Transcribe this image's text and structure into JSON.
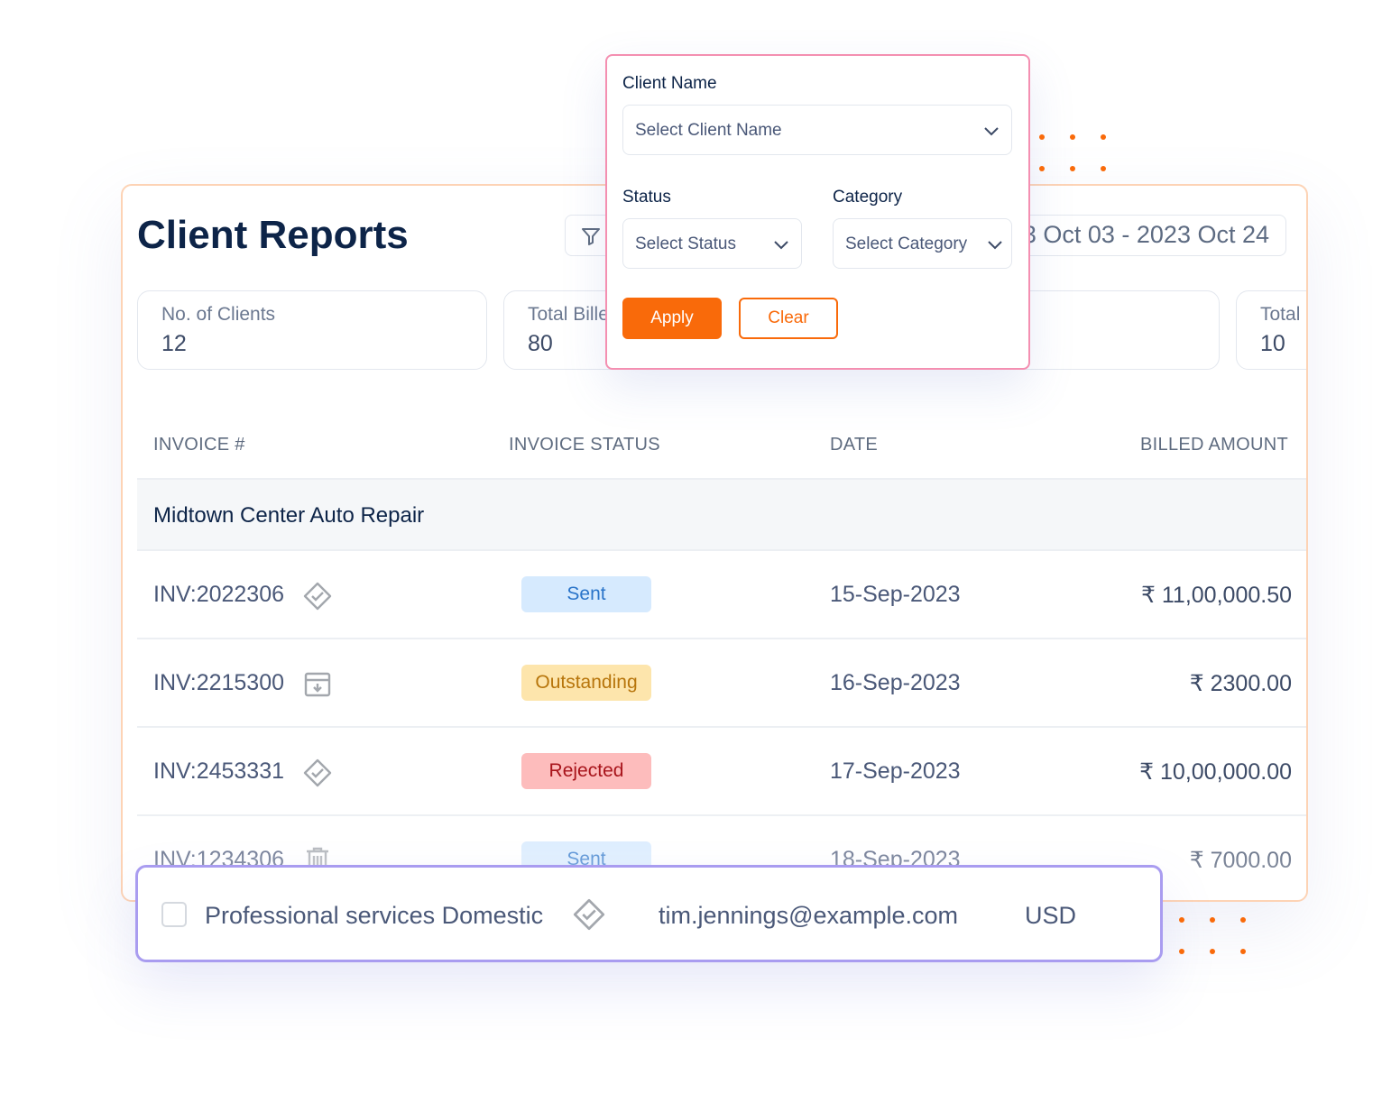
{
  "page": {
    "title": "Client Reports",
    "date_range": "2023 Oct 03 - 2023 Oct 24"
  },
  "stats": [
    {
      "label": "No. of Clients",
      "value": "12"
    },
    {
      "label": "Total Billed",
      "value": "80"
    },
    {
      "label": "",
      "value": ""
    },
    {
      "label": "Total",
      "value": "10"
    }
  ],
  "table": {
    "headers": [
      "INVOICE #",
      "INVOICE STATUS",
      "DATE",
      "BILLED AMOUNT"
    ],
    "group": "Midtown Center Auto Repair",
    "rows": [
      {
        "invoice": "INV:2022306",
        "icon": "approved-check-icon",
        "status": "Sent",
        "date": "15-Sep-2023",
        "amount": "₹ 11,00,000.50"
      },
      {
        "invoice": "INV:2215300",
        "icon": "archive-download-icon",
        "status": "Outstanding",
        "date": "16-Sep-2023",
        "amount": "₹ 2300.00"
      },
      {
        "invoice": "INV:2453331",
        "icon": "approved-check-icon",
        "status": "Rejected",
        "date": "17-Sep-2023",
        "amount": "₹ 10,00,000.00"
      },
      {
        "invoice": "INV:1234306",
        "icon": "trash-icon",
        "status": "Sent",
        "date": "18-Sep-2023",
        "amount": "₹ 7000.00"
      }
    ]
  },
  "status_colors": {
    "Sent": {
      "bg": "#d6eafe",
      "fg": "#2a74c9"
    },
    "Outstanding": {
      "bg": "#fde5ac",
      "fg": "#b7750b"
    },
    "Rejected": {
      "bg": "#fdbcbc",
      "fg": "#a8141b"
    }
  },
  "filter": {
    "client_label": "Client Name",
    "client_placeholder": "Select Client Name",
    "status_label": "Status",
    "status_placeholder": "Select Status",
    "category_label": "Category",
    "category_placeholder": "Select Category",
    "apply": "Apply",
    "clear": "Clear"
  },
  "floating_row": {
    "name": "Professional services Domestic",
    "email": "tim.jennings@example.com",
    "currency": "USD",
    "checked": false
  },
  "colors": {
    "accent": "#f96a0a",
    "title": "#0d2448"
  }
}
